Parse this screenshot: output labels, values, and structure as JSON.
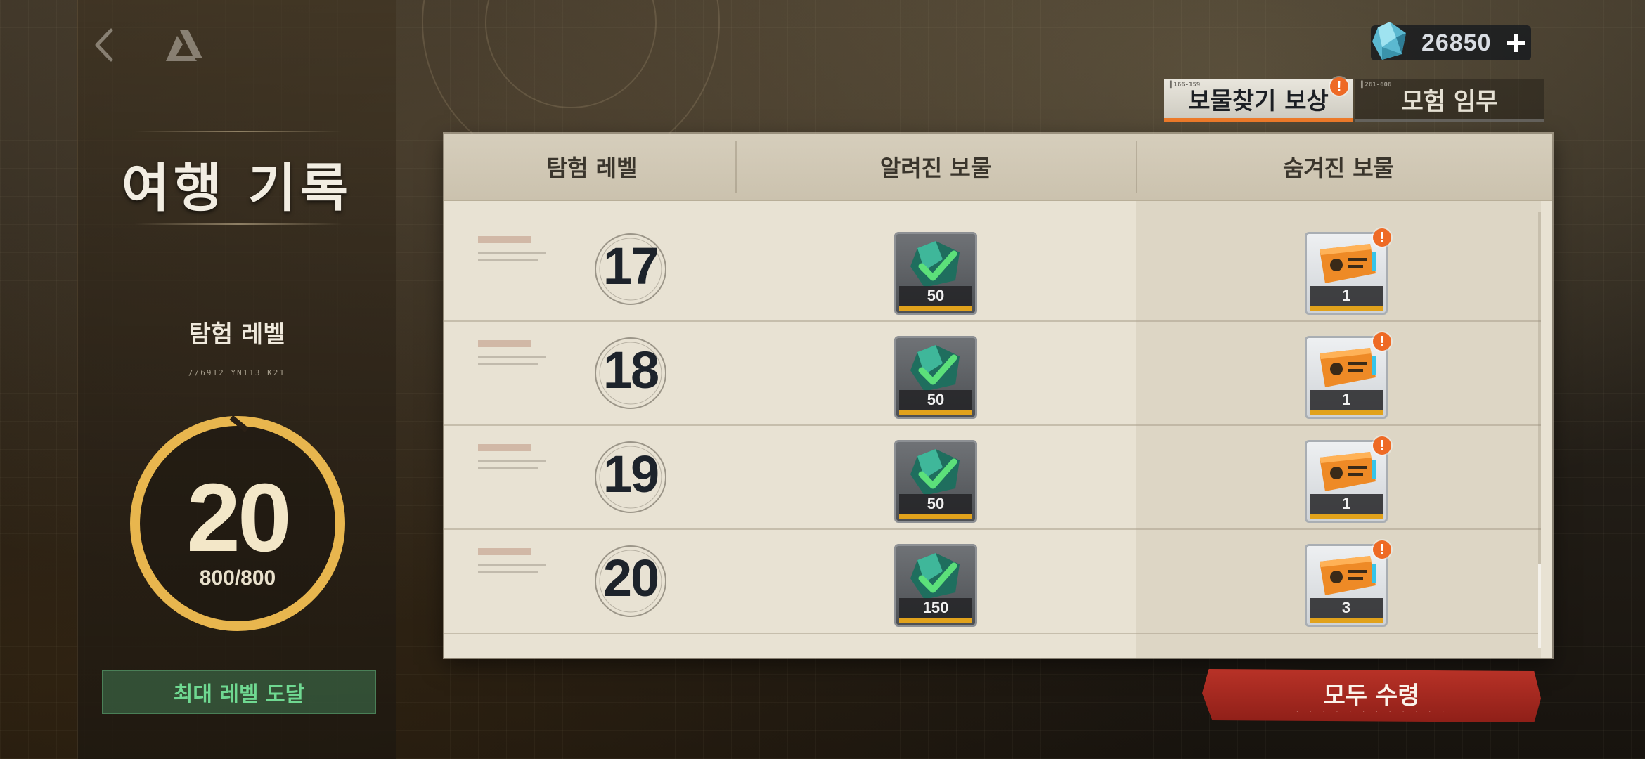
{
  "currency": {
    "icon": "crystal-gem-icon",
    "amount": "26850"
  },
  "tabs": [
    {
      "label": "보물찾기 보상",
      "code": "▌166-159",
      "active": true,
      "alert": "!"
    },
    {
      "label": "모험 임무",
      "code": "▌261-606",
      "active": false
    }
  ],
  "left_panel": {
    "title": "여행 기록",
    "exp_label": "탐험 레벨",
    "exp_code": "//6912 YN113 K21",
    "level": "20",
    "exp": "800/800",
    "max_level_text": "최대 레벨 도달"
  },
  "table": {
    "headers": [
      "탐험 레벨",
      "알려진 보물",
      "숨겨진 보물"
    ],
    "rows": [
      {
        "level": "17",
        "known_qty": "50",
        "hidden_qty": "1"
      },
      {
        "level": "18",
        "known_qty": "50",
        "hidden_qty": "1"
      },
      {
        "level": "19",
        "known_qty": "50",
        "hidden_qty": "1"
      },
      {
        "level": "20",
        "known_qty": "150",
        "hidden_qty": "3"
      }
    ]
  },
  "claim_all": {
    "label": "모두 수령"
  },
  "colors": {
    "accent_orange": "#ef7b2a",
    "alert": "#ee6a25",
    "level_ring": "#e8b64e",
    "claim_red": "#b83227",
    "max_green": "#6fd891"
  }
}
